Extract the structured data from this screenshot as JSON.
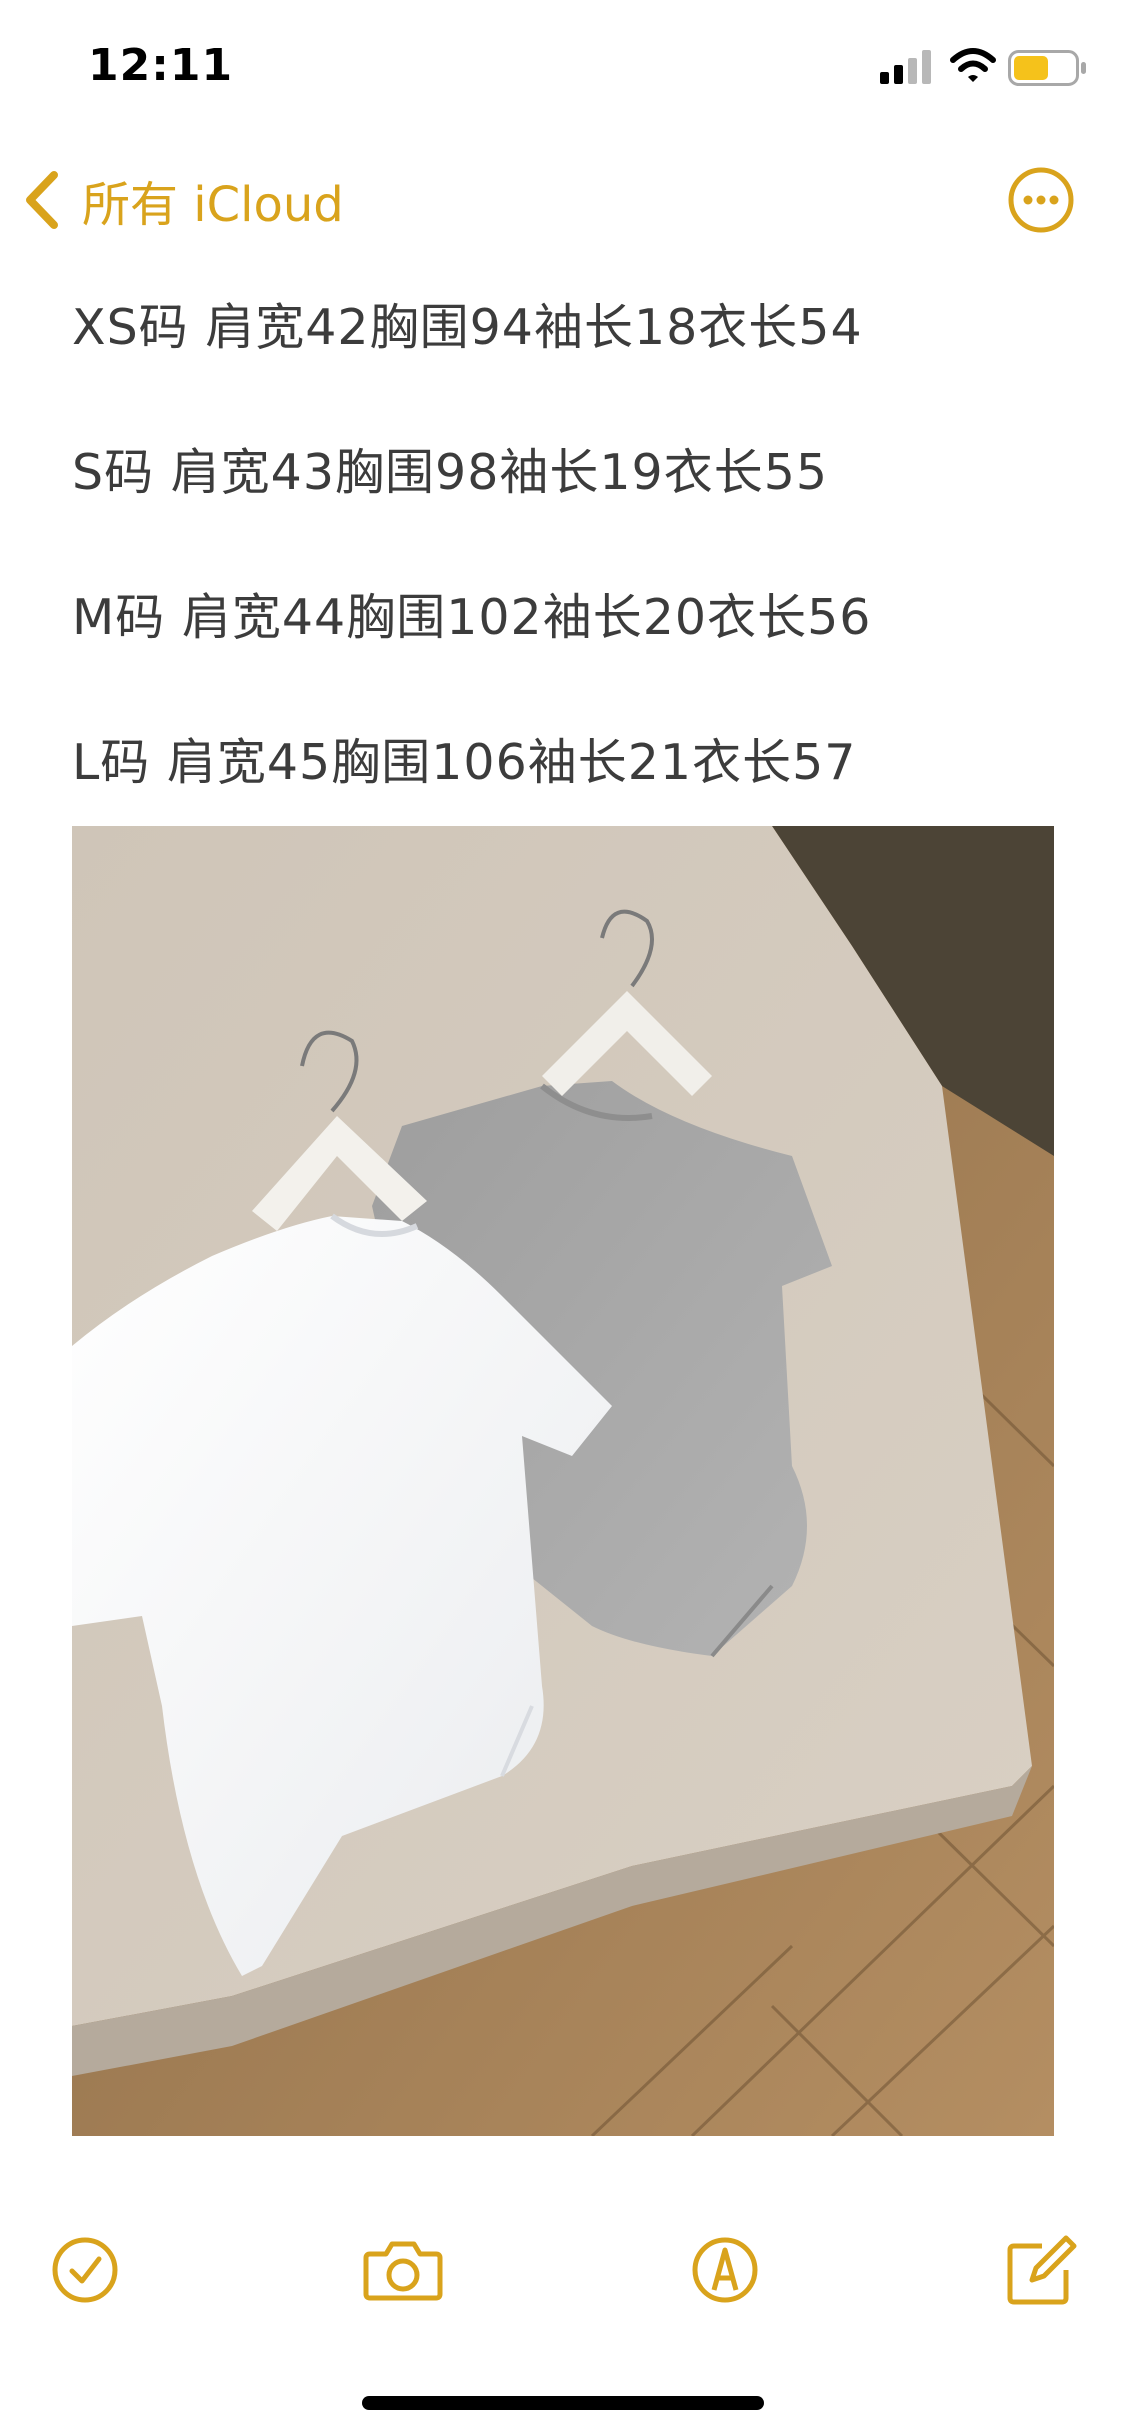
{
  "status_bar": {
    "time": "12:11",
    "signal_icon": "cellular-signal-icon",
    "wifi_icon": "wifi-icon",
    "battery_icon": "battery-icon",
    "battery_color": "#f5c21b"
  },
  "nav": {
    "back_label": "所有 iCloud",
    "back_icon": "chevron-left-icon",
    "more_icon": "ellipsis-circle-icon",
    "accent_color": "#d9a31c"
  },
  "note": {
    "lines": [
      "XS码 肩宽42胸围94袖长18衣长54",
      "S码 肩宽43胸围98袖长19衣长55",
      "M码 肩宽44胸围102袖长20衣长56",
      "L码 肩宽45胸围106袖长21衣长57"
    ],
    "photo": "photo-two-knit-tshirts-on-hangers"
  },
  "toolbar": {
    "icons": [
      "checklist-icon",
      "camera-icon",
      "markup-pen-icon",
      "compose-icon"
    ]
  }
}
